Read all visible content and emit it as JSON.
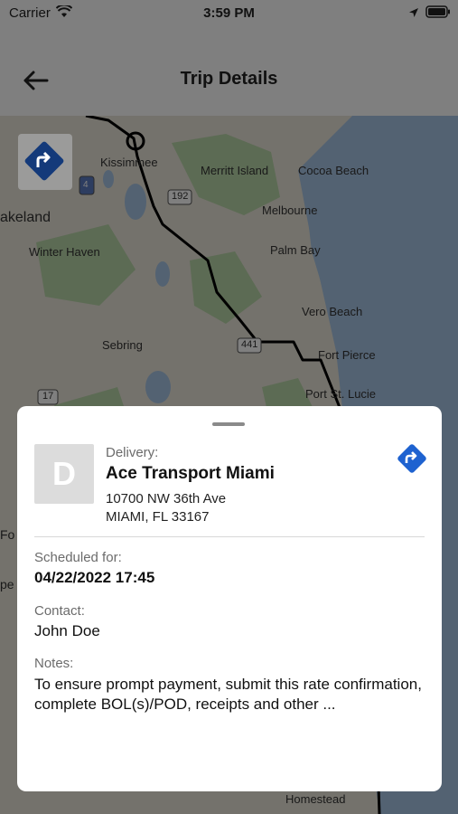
{
  "status_bar": {
    "carrier": "Carrier",
    "time": "3:59 PM"
  },
  "header": {
    "title": "Trip Details"
  },
  "map": {
    "labels": [
      "Kissimmee",
      "Merritt Island",
      "Cocoa Beach",
      "akeland",
      "Melbourne",
      "Winter Haven",
      "Palm Bay",
      "Vero Beach",
      "Sebring",
      "Fort Pierce",
      "Port St. Lucie",
      "Homestead",
      "Fo",
      "pe"
    ],
    "shields": [
      "4",
      "192",
      "441",
      "17"
    ]
  },
  "stop": {
    "avatar_letter": "D",
    "type_label": "Delivery:",
    "name": "Ace Transport Miami",
    "address_line1": "10700 NW 36th Ave",
    "address_line2": "MIAMI, FL 33167",
    "scheduled_label": "Scheduled for:",
    "scheduled_value": "04/22/2022 17:45",
    "contact_label": "Contact:",
    "contact_value": "John Doe",
    "notes_label": "Notes:",
    "notes_value": "To ensure prompt payment, submit this rate confirmation, complete BOL(s)/POD, receipts and other ..."
  },
  "colors": {
    "accent": "#1e62d0",
    "map_land": "#e8e4d8",
    "map_water": "#a7c4e4",
    "route": "#000000"
  }
}
